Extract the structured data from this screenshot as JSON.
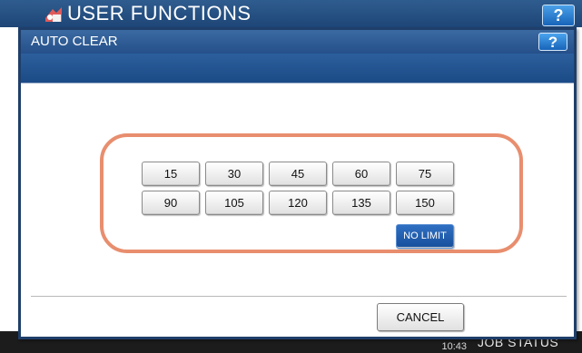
{
  "background": {
    "title": "USER FUNCTIONS",
    "help_label": "?",
    "clock_time": "10:43",
    "job_status_label": "JOB STATUS"
  },
  "dialog": {
    "title": "AUTO CLEAR",
    "help_label": "?",
    "options": [
      "15",
      "30",
      "45",
      "60",
      "75",
      "90",
      "105",
      "120",
      "135",
      "150",
      "NO LIMIT"
    ],
    "selected_option": "NO LIMIT",
    "cancel_label": "CANCEL"
  },
  "colors": {
    "title_bar": "#25508a",
    "selected_button": "#1f5aa8",
    "frame_highlight": "#e88e6e"
  }
}
